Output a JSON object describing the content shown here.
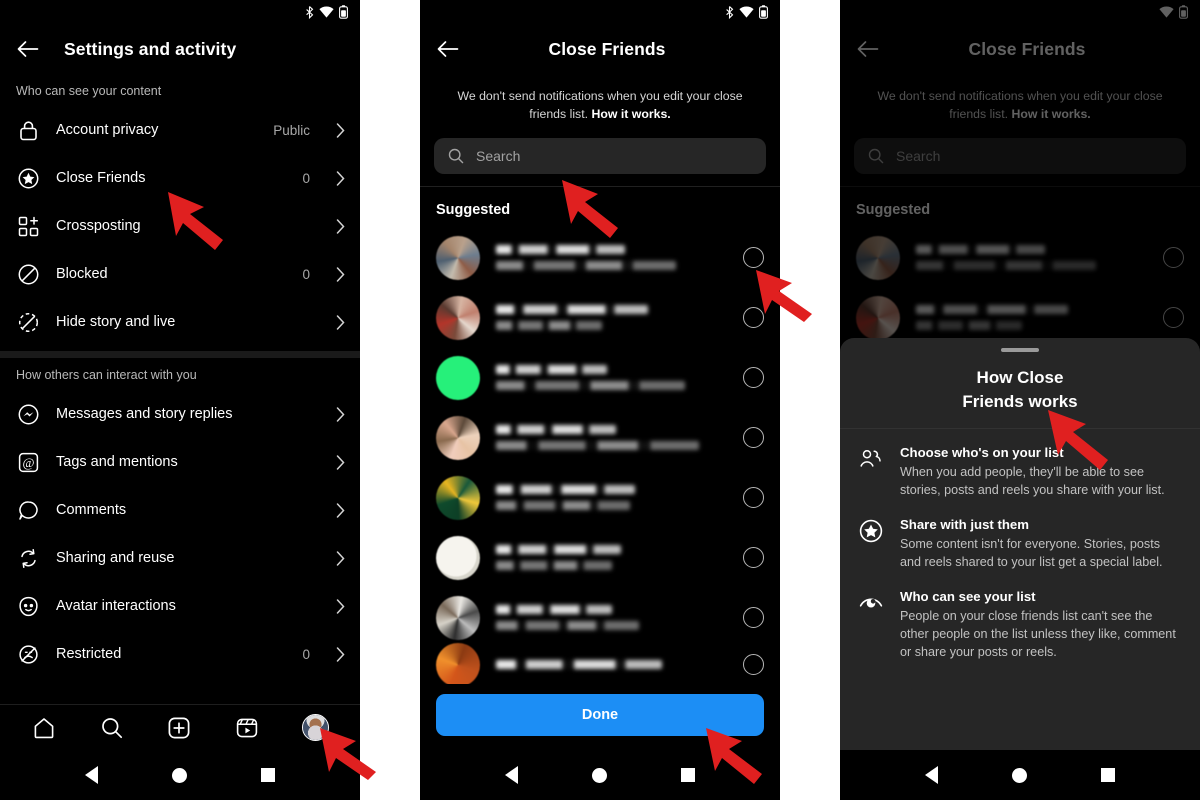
{
  "gap_color": "#ffffff",
  "accent_blue": "#1c8ef5",
  "arrow_color": "#e02020",
  "panel1": {
    "name": "settings-and-activity-screen",
    "statusbar": {
      "icons": [
        "bluetooth-icon",
        "wifi-icon",
        "battery-icon"
      ]
    },
    "appbar": {
      "back": "back-arrow-icon",
      "title": "Settings and activity"
    },
    "section1": {
      "label": "Who can see your content",
      "items": [
        {
          "icon": "lock-icon",
          "label": "Account privacy",
          "value": "Public"
        },
        {
          "icon": "star-circle-icon",
          "label": "Close Friends",
          "value": "0"
        },
        {
          "icon": "grid-plus-icon",
          "label": "Crossposting",
          "value": ""
        },
        {
          "icon": "block-icon",
          "label": "Blocked",
          "value": "0"
        },
        {
          "icon": "hide-story-icon",
          "label": "Hide story and live",
          "value": ""
        }
      ]
    },
    "section2": {
      "label": "How others can interact with you",
      "items": [
        {
          "icon": "messenger-icon",
          "label": "Messages and story replies",
          "value": ""
        },
        {
          "icon": "at-mention-icon",
          "label": "Tags and mentions",
          "value": ""
        },
        {
          "icon": "comment-bubble-icon",
          "label": "Comments",
          "value": ""
        },
        {
          "icon": "reshare-icon",
          "label": "Sharing and reuse",
          "value": ""
        },
        {
          "icon": "avatar-face-icon",
          "label": "Avatar interactions",
          "value": ""
        },
        {
          "icon": "restricted-icon",
          "label": "Restricted",
          "value": "0"
        }
      ]
    },
    "bottomnav": {
      "items": [
        "home-icon",
        "search-icon",
        "create-plus-icon",
        "reels-icon",
        "profile-avatar"
      ]
    }
  },
  "panel2": {
    "name": "close-friends-picker-screen",
    "statusbar": {
      "icons": [
        "bluetooth-icon",
        "wifi-icon",
        "battery-icon"
      ]
    },
    "appbar": {
      "back": "back-arrow-icon",
      "title": "Close Friends"
    },
    "blurb": {
      "text": "We don't send notifications when you edit your close friends list. ",
      "link": "How it works."
    },
    "search": {
      "placeholder": "Search",
      "value": "",
      "icon": "search-icon"
    },
    "suggested_header": "Suggested",
    "suggested_rows": [
      {
        "avatar": "#9fa9b4",
        "name_hidden": true,
        "selected": false
      },
      {
        "avatar": "#b4756a",
        "name_hidden": true,
        "selected": false
      },
      {
        "avatar": "#2ff37f",
        "name_hidden": true,
        "selected": false
      },
      {
        "avatar": "#d9a98e",
        "name_hidden": true,
        "selected": false
      },
      {
        "avatar": "#1d5b38",
        "name_hidden": true,
        "selected": false
      },
      {
        "avatar": "#e8e8e2",
        "name_hidden": true,
        "selected": false
      },
      {
        "avatar": "#9a9a9a",
        "name_hidden": true,
        "selected": false
      },
      {
        "avatar": "#c1521d",
        "name_hidden": true,
        "selected": false
      }
    ],
    "done_label": "Done"
  },
  "panel3": {
    "name": "close-friends-how-it-works-sheet",
    "statusbar": {
      "icons": [
        "wifi-icon",
        "battery-icon"
      ]
    },
    "appbar": {
      "back": "back-arrow-icon",
      "title": "Close Friends"
    },
    "blurb": {
      "text": "We don't send notifications when you edit your close friends list. ",
      "link": "How it works."
    },
    "search": {
      "placeholder": "Search",
      "value": "",
      "icon": "search-icon"
    },
    "suggested_header": "Suggested",
    "sheet": {
      "handle": "drag-handle",
      "title": "How Close\nFriends works",
      "title_line1": "How Close",
      "title_line2": "Friends works",
      "items": [
        {
          "icon": "people-group-icon",
          "heading": "Choose who's on your list",
          "body": "When you add people, they'll be able to see stories, posts and reels you share with your list."
        },
        {
          "icon": "star-circle-icon",
          "heading": "Share with just them",
          "body": "Some content isn't for everyone. Stories, posts and reels shared to your list get a special label."
        },
        {
          "icon": "eye-icon",
          "heading": "Who can see your list",
          "body": "People on your close friends list can't see the other people on the list unless they like, comment or share your posts or reels."
        }
      ]
    }
  },
  "annotations": [
    {
      "name": "arrow-to-close-friends-row",
      "target": "Close Friends"
    },
    {
      "name": "arrow-to-profile-tab",
      "target": "profile-avatar"
    },
    {
      "name": "arrow-to-search-field",
      "target": "Search"
    },
    {
      "name": "arrow-to-select-circle",
      "target": "suggested-row-1-circle"
    },
    {
      "name": "arrow-to-done-button",
      "target": "Done"
    },
    {
      "name": "arrow-to-sheet-title",
      "target": "How Close Friends works"
    }
  ]
}
